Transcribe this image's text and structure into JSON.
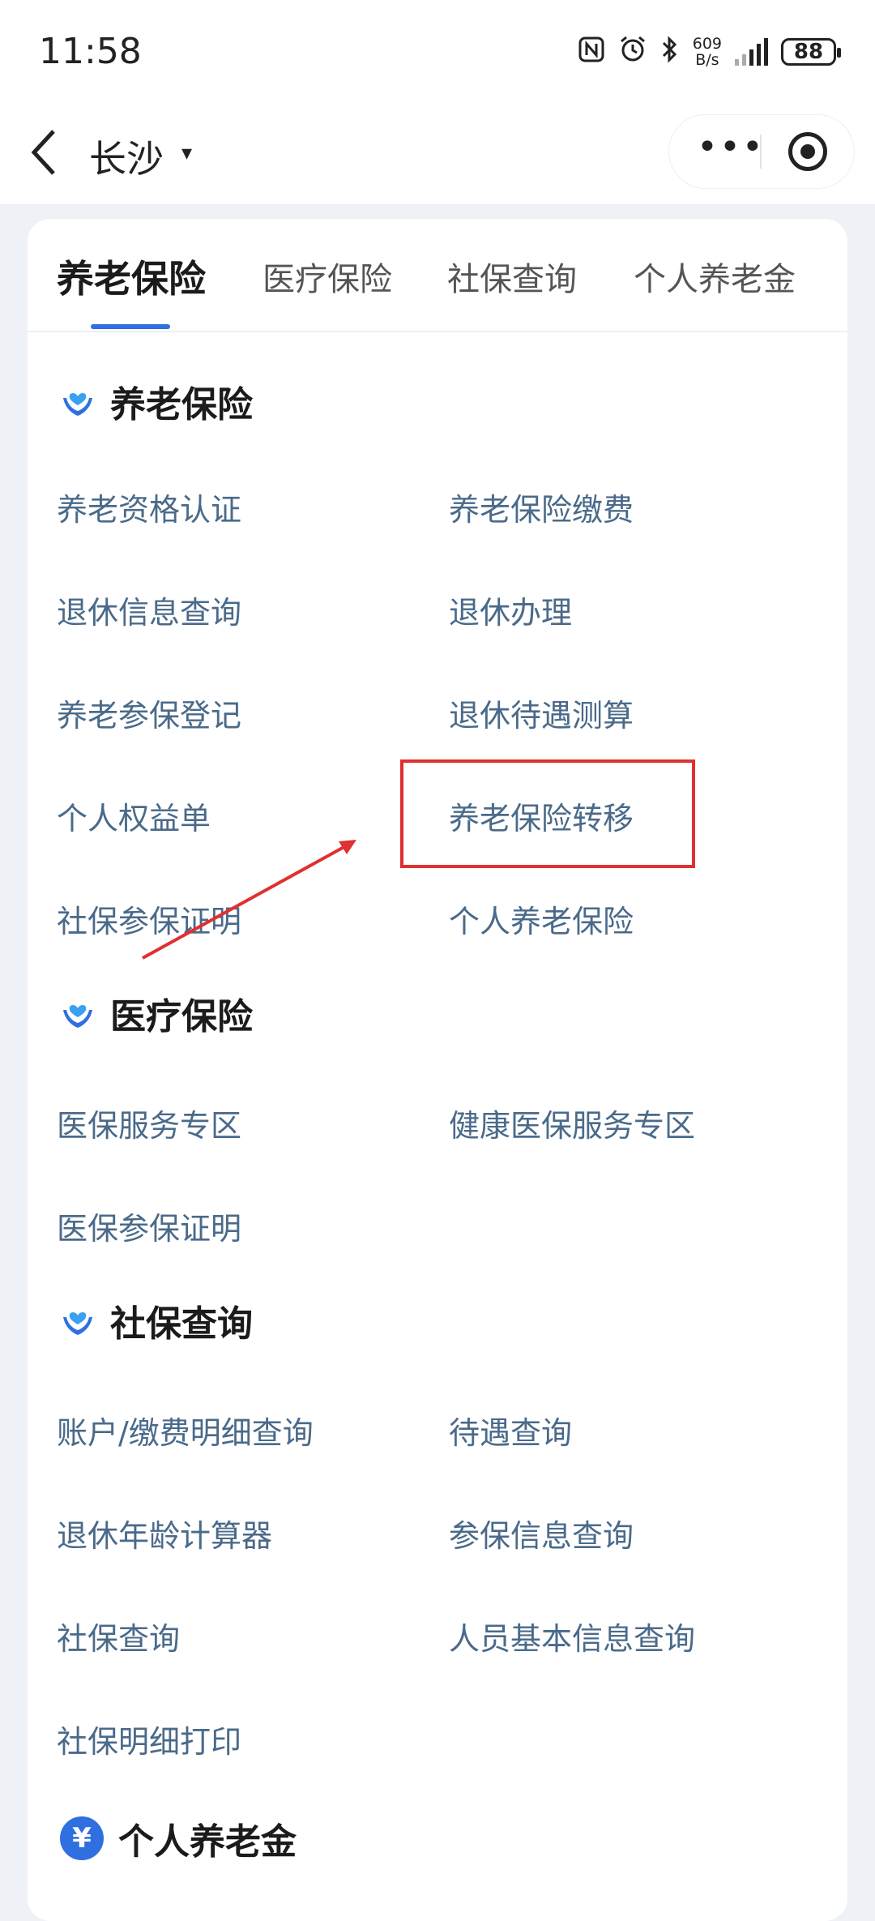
{
  "status_bar": {
    "time": "11:58",
    "net_speed_value": "609",
    "net_speed_unit": "B/s",
    "battery": "88",
    "icons": [
      "nfc-icon",
      "alarm-icon",
      "bluetooth-icon",
      "signal-icon",
      "battery-icon"
    ]
  },
  "nav": {
    "back_icon": "chevron-left-icon",
    "city": "长沙",
    "city_caret": "▾",
    "more_label": "•••",
    "capsule_icons": [
      "more-icon",
      "close-target-icon"
    ]
  },
  "tabs": [
    {
      "label": "养老保险",
      "active": true
    },
    {
      "label": "医疗保险",
      "active": false
    },
    {
      "label": "社保查询",
      "active": false
    },
    {
      "label": "个人养老金",
      "active": false
    }
  ],
  "sections": [
    {
      "title": "养老保险",
      "icon": "hands-heart-icon",
      "items": [
        "养老资格认证",
        "养老保险缴费",
        "退休信息查询",
        "退休办理",
        "养老参保登记",
        "退休待遇测算",
        "个人权益单",
        "养老保险转移",
        "社保参保证明",
        "个人养老保险"
      ]
    },
    {
      "title": "医疗保险",
      "icon": "hands-heart-icon",
      "items": [
        "医保服务专区",
        "健康医保服务专区",
        "医保参保证明"
      ]
    },
    {
      "title": "社保查询",
      "icon": "hands-heart-icon",
      "items": [
        "账户/缴费明细查询",
        "待遇查询",
        "退休年龄计算器",
        "参保信息查询",
        "社保查询",
        "人员基本信息查询",
        "社保明细打印"
      ]
    },
    {
      "title": "个人养老金",
      "icon": "yuan-coin-icon",
      "icon_glyph": "¥",
      "items": []
    }
  ],
  "annotation": {
    "highlighted_item": "养老保险转移",
    "highlight_color": "#e03030"
  },
  "colors": {
    "accent": "#2f6fe0",
    "item_text": "#4a6a8a",
    "background": "#eef1f5"
  }
}
